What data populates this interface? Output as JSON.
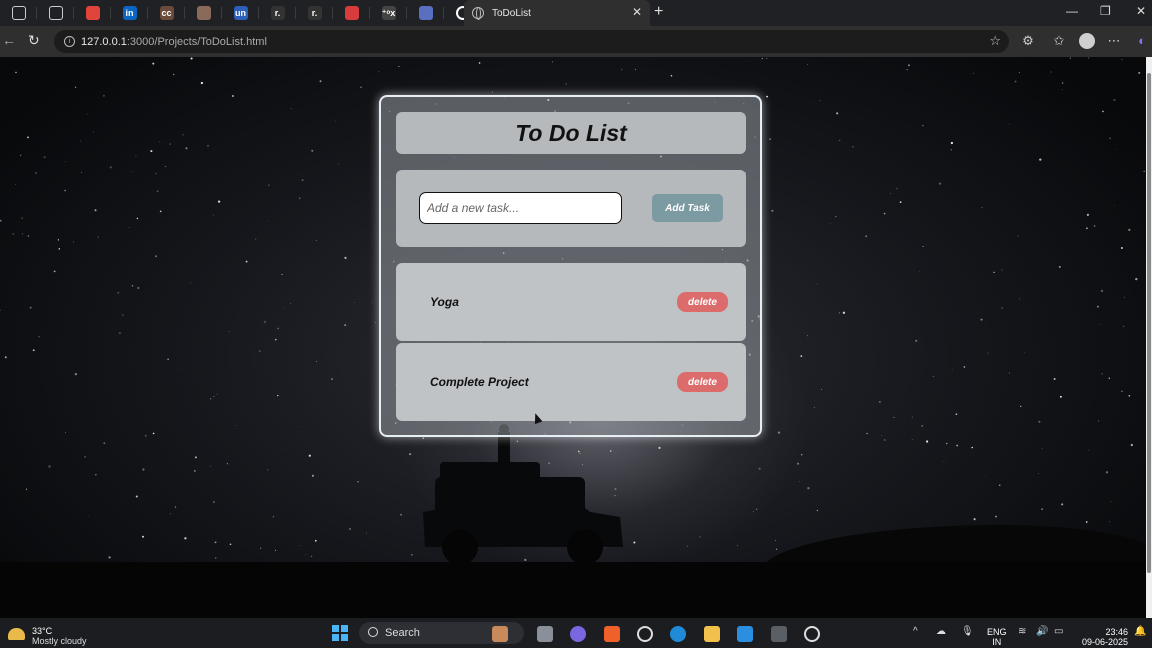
{
  "browser": {
    "tab_title": "ToDoList",
    "url_host": "127.0.0.1",
    "url_path": ":3000/Projects/ToDoList.html",
    "pinned_tabs": [
      {
        "icon": "workspaces-icon",
        "label": ""
      },
      {
        "icon": "tab-actions-icon",
        "label": ""
      },
      {
        "icon": "app-icon-red",
        "label": "",
        "color": "#e0443a"
      },
      {
        "icon": "linkedin-icon",
        "label": "in",
        "color": "#0a66c2"
      },
      {
        "icon": "codechef-icon",
        "label": "cc",
        "color": "#6b4a3a"
      },
      {
        "icon": "page-icon",
        "label": "",
        "color": "#8a6a5a"
      },
      {
        "icon": "unstop-icon",
        "label": "un",
        "color": "#2b5fb8"
      },
      {
        "icon": "github-icon-1",
        "label": "r.",
        "color": "#333333"
      },
      {
        "icon": "github-icon-2",
        "label": "r.",
        "color": "#333333"
      },
      {
        "icon": "app-icon-red-2",
        "label": "",
        "color": "#d83b3b"
      },
      {
        "icon": "tab-icon-plain",
        "label": "⁺ᵒx",
        "color": "#444444"
      },
      {
        "icon": "postman-icon",
        "label": "",
        "color": "#5a6fc0"
      },
      {
        "icon": "github-logo-icon",
        "label": "",
        "color": "#ffffff"
      }
    ]
  },
  "todo": {
    "title": "To Do List",
    "input_placeholder": "Add a new task...",
    "add_button": "Add Task",
    "tasks": [
      {
        "label": "Yoga",
        "delete_label": "delete"
      },
      {
        "label": "Complete Project",
        "delete_label": "delete"
      }
    ],
    "colors": {
      "add_button": "#7c9aa2",
      "delete_button": "#dc6b6b"
    }
  },
  "taskbar": {
    "temperature": "33°C",
    "weather": "Mostly cloudy",
    "search_label": "Search",
    "language_1": "ENG",
    "language_2": "IN",
    "time": "23:46",
    "date": "09-06-2025"
  }
}
